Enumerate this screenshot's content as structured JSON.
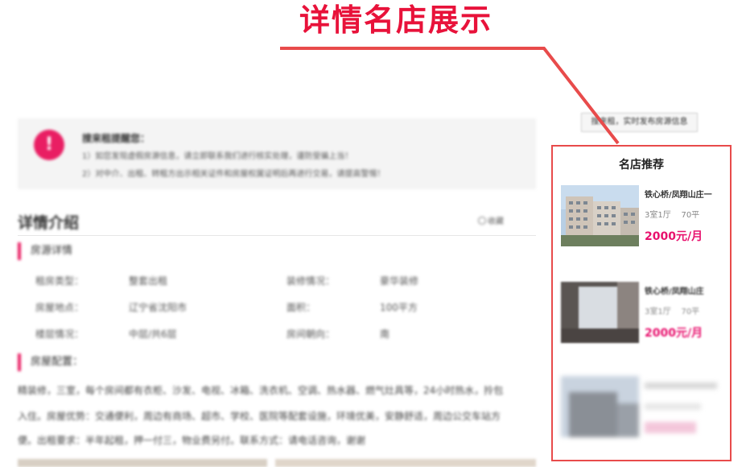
{
  "annotation": {
    "headline": "详情名店展示"
  },
  "notice": {
    "title": "搜来租提醒您：",
    "line1": "1）如您发现虚假房源信息，请立即联系我们进行核实处理，谨防受骗上当！",
    "line2": "2）对中介、出租、转租方出示相关证件和房屋权属证明后再进行交易，请提高警惕！"
  },
  "detail": {
    "title": "详情介绍",
    "collect_label": "收藏",
    "basic_heading": "房源详情",
    "rows": [
      {
        "k1": "租房类型：",
        "v1": "整套出租",
        "k2": "装修情况：",
        "v2": "豪华装修"
      },
      {
        "k1": "房屋地点：",
        "v1": "辽宁省沈阳市",
        "k2": "面积：",
        "v2": "100平方"
      },
      {
        "k1": "楼层情况：",
        "v1": "中层/共6层",
        "k2": "房间朝向：",
        "v2": "南"
      }
    ],
    "facility_heading": "房屋配置：",
    "facility_lines": [
      "精装修，三室，每个房间都有衣柜、沙发、电视、冰箱、洗衣机、空调、热水器、燃气灶具等，24小时热水，拎包",
      "入住。房屋优势：交通便利，周边有商场、超市、学校、医院等配套设施，环境优美，安静舒适，周边公交车站方",
      "便。出租要求：半年起租，押一付三，物业费另付。联系方式：请电话咨询，谢谢"
    ]
  },
  "sidebar": {
    "button_label": "搜来租，实时发布房源信息"
  },
  "recommend": {
    "title": "名店推荐",
    "items": [
      {
        "name": "铁心桥/凤翔山庄一",
        "layout": "3室1厅",
        "area": "70平",
        "price": "2000元/月"
      },
      {
        "name": "铁心桥/凤翔山庄",
        "layout": "3室1厅",
        "area": "70平",
        "price": "2000元/月"
      },
      {
        "name": "",
        "layout": "",
        "area": "",
        "price": ""
      }
    ]
  },
  "colors": {
    "accent_pink": "#e8126e",
    "headline_red": "#e8123a",
    "frame_red": "#e84b4b"
  },
  "icons": {
    "notice": "bell-exclaim-icon",
    "collect": "circle-star-icon"
  }
}
